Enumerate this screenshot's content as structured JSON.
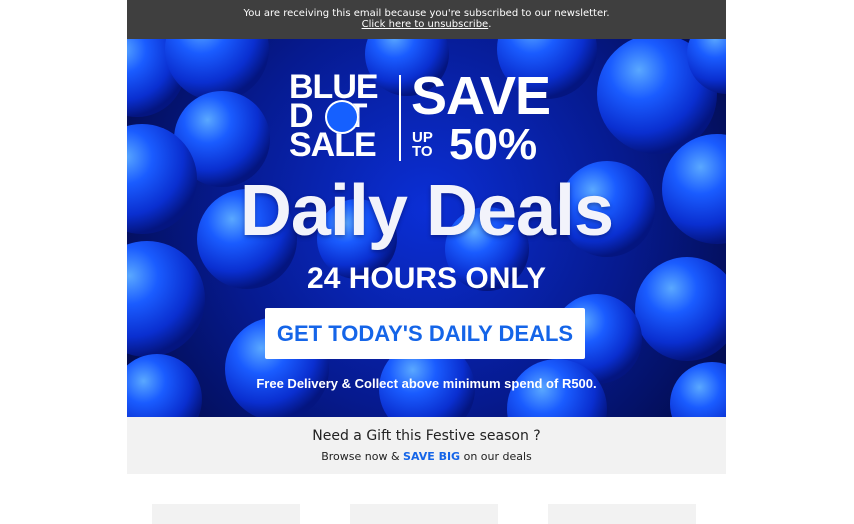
{
  "topbar": {
    "notice": "You are receiving this email because you're subscribed to our newsletter.",
    "unsubscribe_link": "Click here to unsubscribe",
    "unsubscribe_suffix": "."
  },
  "hero": {
    "logo_lines": [
      "BLUE",
      "D",
      "T",
      "SALE"
    ],
    "save": "SAVE",
    "up": "UP",
    "to": "TO",
    "percent": "50%",
    "headline": "Daily Deals",
    "subheadline": "24 HOURS ONLY",
    "cta": "GET TODAY'S DAILY DEALS",
    "footnote": "Free Delivery & Collect above minimum spend of R500."
  },
  "gift": {
    "heading": "Need a Gift this Festive season ?",
    "sub_prefix": "Browse now & ",
    "sub_highlight": "SAVE BIG",
    "sub_suffix": " on our deals"
  },
  "colors": {
    "brand_blue": "#1565e8",
    "topbar_bg": "#3f3f3f",
    "panel_bg": "#f2f2f2"
  }
}
